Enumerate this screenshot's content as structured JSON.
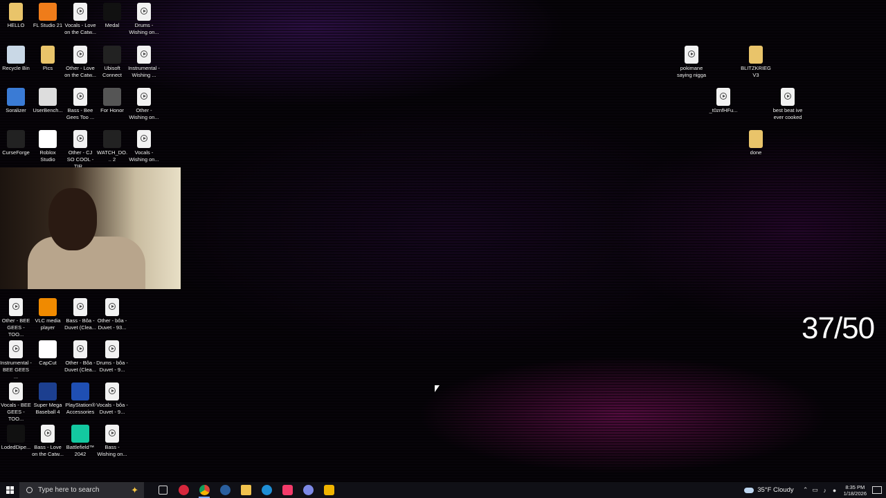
{
  "desktop": {
    "icons_col1": [
      {
        "label": "HELLO",
        "icon": "folder-icon"
      },
      {
        "label": "Recycle Bin",
        "icon": "recycle-bin-icon"
      },
      {
        "label": "Soralizer",
        "icon": "app-icon"
      },
      {
        "label": "CurseForge",
        "icon": "curseforge-icon"
      }
    ],
    "icons_col2": [
      {
        "label": "FL Studio 21",
        "icon": "fl-studio-icon"
      },
      {
        "label": "Pics",
        "icon": "folder-icon"
      },
      {
        "label": "UserBench...",
        "icon": "userbenchmark-icon"
      },
      {
        "label": "Roblox Studio",
        "icon": "roblox-studio-icon"
      }
    ],
    "icons_col3": [
      {
        "label": "Vocals - Love on the Catw...",
        "icon": "media-file-icon"
      },
      {
        "label": "Other - Love on the Catw...",
        "icon": "media-file-icon"
      },
      {
        "label": "Bass - Bee Gees Too ...",
        "icon": "media-file-icon"
      },
      {
        "label": "Other - CJ SO COOL - TIR...",
        "icon": "media-file-icon"
      }
    ],
    "icons_col4": [
      {
        "label": "Medal",
        "icon": "medal-icon"
      },
      {
        "label": "Ubisoft Connect",
        "icon": "ubisoft-icon"
      },
      {
        "label": "For Honor",
        "icon": "for-honor-icon"
      },
      {
        "label": "WATCH_DO... 2",
        "icon": "watch-dogs-icon"
      }
    ],
    "icons_col5": [
      {
        "label": "Drums - Wishing on...",
        "icon": "media-file-icon"
      },
      {
        "label": "Instrumental - Wishing ...",
        "icon": "media-file-icon"
      },
      {
        "label": "Other - Wishing on...",
        "icon": "media-file-icon"
      },
      {
        "label": "Vocals - Wishing on...",
        "icon": "media-file-icon"
      }
    ],
    "icons_bottom": [
      {
        "label": "Other - BEE GEES - TOO...",
        "icon": "media-file-icon"
      },
      {
        "label": "VLC media player",
        "icon": "vlc-icon"
      },
      {
        "label": "Bass - Bôa - Duvet (Clea...",
        "icon": "media-file-icon"
      },
      {
        "label": "Other - bôa - Duvet - 93...",
        "icon": "media-file-icon"
      },
      {
        "label": "Instrumental - BEE GEES ...",
        "icon": "media-file-icon"
      },
      {
        "label": "CapCut",
        "icon": "capcut-icon"
      },
      {
        "label": "Other - Bôa - Duvet (Clea...",
        "icon": "media-file-icon"
      },
      {
        "label": "Drums - bôa - Duvet - 9...",
        "icon": "media-file-icon"
      },
      {
        "label": "Vocals - BEE GEES - TOO...",
        "icon": "media-file-icon"
      },
      {
        "label": "Super Mega Baseball 4",
        "icon": "smb4-icon"
      },
      {
        "label": "PlayStation® Accessories",
        "icon": "playstation-icon"
      },
      {
        "label": "Vocals - bôa - Duvet - 9...",
        "icon": "media-file-icon"
      },
      {
        "label": "LodedDipe...",
        "icon": "abc-icon"
      },
      {
        "label": "Bass - Love on the Catw...",
        "icon": "media-file-icon"
      },
      {
        "label": "Battlefield™ 2042",
        "icon": "battlefield-icon"
      },
      {
        "label": "Bass - Wishing on...",
        "icon": "media-file-icon"
      }
    ],
    "icons_right": [
      {
        "label": "pokimane saying nigga",
        "icon": "media-file-icon"
      },
      {
        "label": "BLITZKRIEG V3",
        "icon": "folder-icon"
      },
      {
        "label": "_t0znfHFu...",
        "icon": "image-file-icon"
      },
      {
        "label": "best beat ive ever cooked",
        "icon": "media-file-icon"
      },
      {
        "label": "done",
        "icon": "folder-icon"
      }
    ]
  },
  "overlay": {
    "counter": "37/50"
  },
  "taskbar": {
    "search_placeholder": "Type here to search",
    "apps": [
      "task-view-icon",
      "opera-gx-icon",
      "chrome-icon",
      "steam-icon",
      "file-explorer-icon",
      "edge-icon",
      "itunes-icon",
      "discord-icon",
      "app-icon"
    ],
    "weather": "35°F  Cloudy",
    "time": "8:35 PM",
    "date": "1/18/2026"
  }
}
